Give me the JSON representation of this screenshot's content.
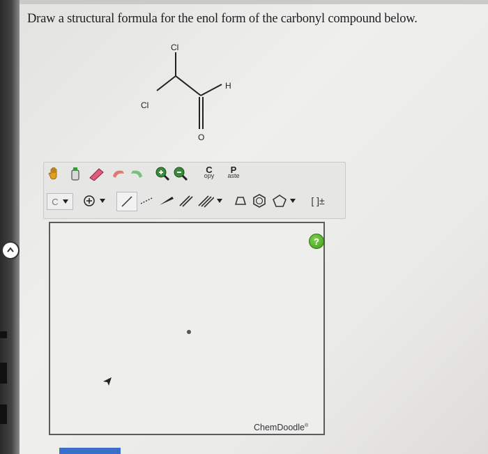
{
  "question": {
    "text": "Draw a structural formula for the enol form of the carbonyl compound below."
  },
  "molecule": {
    "atoms": {
      "cl_top": "Cl",
      "cl_left": "Cl",
      "h": "H",
      "o": "O"
    }
  },
  "toolbar": {
    "copy_top": "C",
    "copy_bottom": "opy",
    "paste_top": "P",
    "paste_bottom": "aste",
    "atom_select": "C",
    "charge_label": "[ ]±"
  },
  "canvas": {
    "help_label": "?",
    "brand": "ChemDoodle",
    "brand_mark": "®"
  },
  "icons": [
    "hand-icon",
    "lasso-icon",
    "eraser-icon",
    "undo-icon",
    "redo-icon",
    "zoom-in-icon",
    "zoom-out-icon",
    "plus-circle-icon",
    "single-bond-icon",
    "dotted-bond-icon",
    "wedge-bond-icon",
    "double-bond-icon",
    "triple-bond-icon",
    "cyclopropane-icon",
    "benzene-icon",
    "pentagon-icon",
    "help-icon",
    "cursor-icon"
  ]
}
